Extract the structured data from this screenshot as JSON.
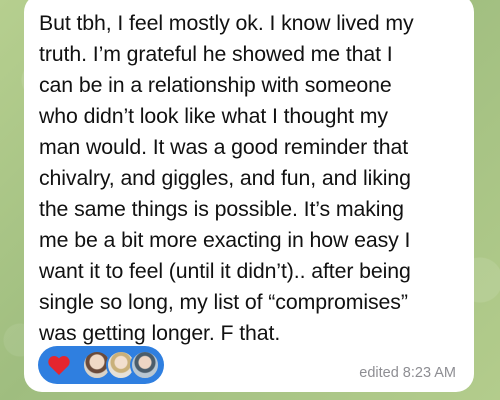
{
  "message": {
    "text": "But tbh, I feel mostly ok. I know lived my\ntruth. I’m grateful he showed me that I\ncan be in a relationship with someone\nwho didn’t look like what I thought my\nman would. It was a good reminder that\nchivalry, and giggles, and fun, and liking\nthe same things is possible. It’s making\nme be a bit more exacting in how easy I\nwant it to feel (until it didn’t).. after being\nsingle so long, my list of “compromises”\nwas getting longer. F that.",
    "status": "edited 8:23 AM"
  },
  "reactions": {
    "emoji": "heart-icon",
    "avatars": [
      "avatar",
      "avatar",
      "avatar"
    ]
  },
  "colors": {
    "background": "#a9c48a",
    "bubble": "#ffffff",
    "reaction_pill": "#2f7fe0",
    "heart": "#e5252e",
    "status_text": "#8e8e93"
  }
}
